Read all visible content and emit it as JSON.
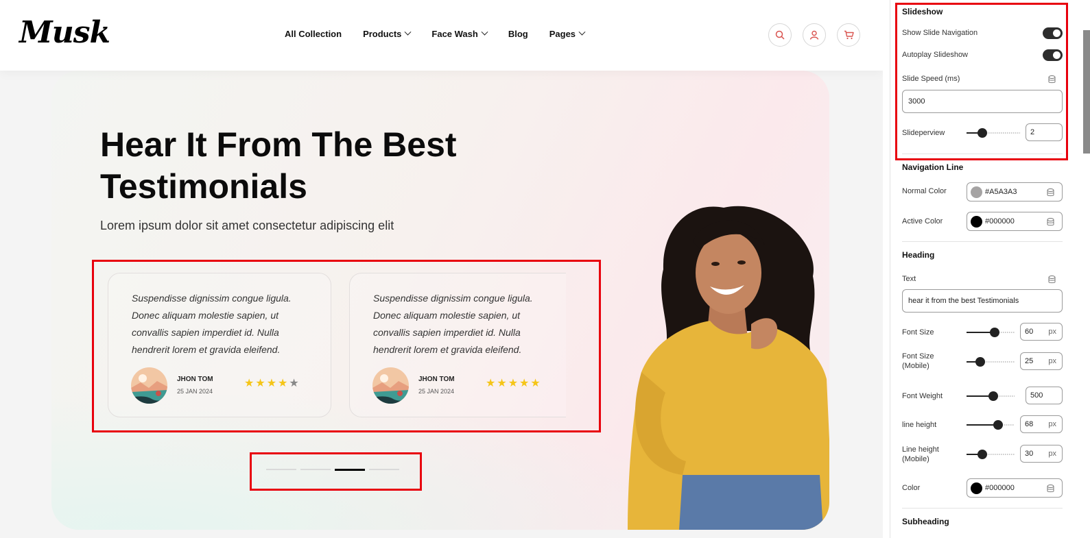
{
  "site": {
    "logo": "Musk",
    "nav": [
      {
        "label": "All Collection",
        "dropdown": false
      },
      {
        "label": "Products",
        "dropdown": true
      },
      {
        "label": "Face Wash",
        "dropdown": true
      },
      {
        "label": "Blog",
        "dropdown": false
      },
      {
        "label": "Pages",
        "dropdown": true
      }
    ],
    "header_icons": [
      "search-icon",
      "user-icon",
      "cart-icon"
    ],
    "accent_color": "#d9534f"
  },
  "hero": {
    "title": "Hear It From The Best Testimonials",
    "subtitle": "Lorem ipsum dolor sit amet consectetur adipiscing elit"
  },
  "testimonials": [
    {
      "text": "Suspendisse dignissim congue ligula. Donec aliquam molestie sapien, ut convallis sapien imperdiet id. Nulla hendrerit lorem et gravida eleifend.",
      "name": "JHON TOM",
      "date": "25 JAN 2024",
      "rating": 4,
      "max_rating": 5
    },
    {
      "text": "Suspendisse dignissim congue ligula. Donec aliquam molestie sapien, ut convallis sapien imperdiet id. Nulla hendrerit lorem et gravida eleifend.",
      "name": "JHON TOM",
      "date": "25 JAN 2024",
      "rating": 5,
      "max_rating": 5
    }
  ],
  "pager": {
    "count": 4,
    "active_index": 2
  },
  "panel": {
    "slideshow": {
      "title": "Slideshow",
      "show_nav_label": "Show Slide Navigation",
      "show_nav_on": true,
      "autoplay_label": "Autoplay Slideshow",
      "autoplay_on": true,
      "speed_label": "Slide Speed (ms)",
      "speed_value": "3000",
      "slideperview_label": "Slideperview",
      "slideperview_value": "2",
      "slideperview_level": 0.3
    },
    "navigation_line": {
      "title": "Navigation Line",
      "normal_label": "Normal Color",
      "normal_value": "#A5A3A3",
      "active_label": "Active Color",
      "active_value": "#000000"
    },
    "heading": {
      "title": "Heading",
      "text_label": "Text",
      "text_value": "hear it from the best Testimonials",
      "font_size_label": "Font Size",
      "font_size_value": "60",
      "font_size_level": 0.58,
      "font_size_mobile_label_1": "Font Size",
      "font_size_mobile_label_2": "(Mobile)",
      "font_size_mobile_value": "25",
      "font_size_mobile_level": 0.28,
      "font_weight_label": "Font Weight",
      "font_weight_value": "500",
      "font_weight_level": 0.55,
      "line_height_label": "line height",
      "line_height_value": "68",
      "line_height_level": 0.65,
      "line_height_mobile_label_1": "Line height",
      "line_height_mobile_label_2": "(Mobile)",
      "line_height_mobile_value": "30",
      "line_height_mobile_level": 0.33,
      "unit": "px",
      "color_label": "Color",
      "color_value": "#000000"
    },
    "subheading": {
      "title": "Subheading"
    }
  }
}
